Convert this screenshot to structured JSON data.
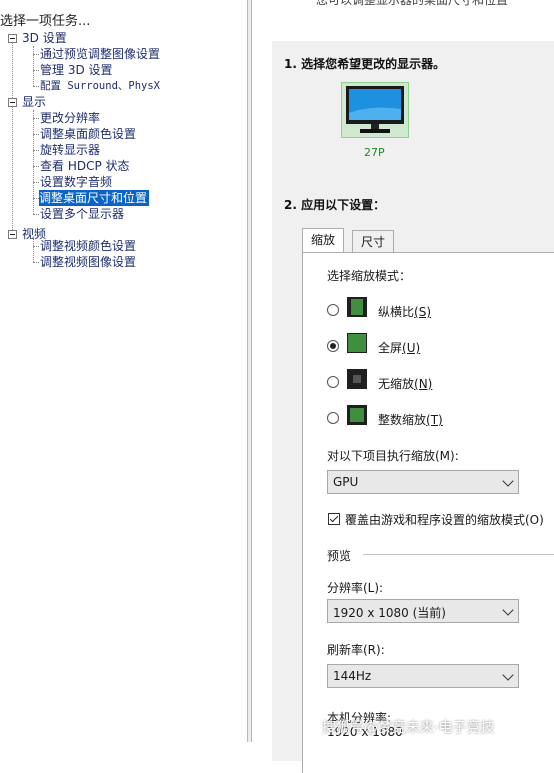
{
  "left_panel": {
    "title": "选择一项任务...",
    "tree": [
      {
        "label": "3D 设置",
        "children": [
          "通过预览调整图像设置",
          "管理 3D 设置",
          "配置 Surround、PhysX"
        ]
      },
      {
        "label": "显示",
        "children": [
          "更改分辨率",
          "调整桌面颜色设置",
          "旋转显示器",
          "查看 HDCP 状态",
          "设置数字音频",
          "调整桌面尺寸和位置",
          "设置多个显示器"
        ]
      },
      {
        "label": "视频",
        "children": [
          "调整视频颜色设置",
          "调整视频图像设置"
        ]
      }
    ],
    "selected": "调整桌面尺寸和位置"
  },
  "header_cut_text": "您可以调整显示器的桌面尺寸和位置",
  "step1": {
    "title": "1.  选择您希望更改的显示器。",
    "monitor_label": "27P",
    "monitor_icon": "monitor-icon"
  },
  "step2": {
    "title": "2.  应用以下设置："
  },
  "tabs": [
    "缩放",
    "尺寸"
  ],
  "scaling": {
    "mode_label": "选择缩放模式：",
    "modes": [
      {
        "label": "纵横比",
        "hotkey": "(S)",
        "checked": false,
        "icon": "aspect-ratio-icon"
      },
      {
        "label": "全屏",
        "hotkey": "(U)",
        "checked": true,
        "icon": "fullscreen-icon"
      },
      {
        "label": "无缩放",
        "hotkey": "(N)",
        "checked": false,
        "icon": "no-scaling-icon"
      },
      {
        "label": "整数缩放",
        "hotkey": "(T)",
        "checked": false,
        "icon": "integer-scaling-icon"
      }
    ],
    "perform_on_label": "对以下项目执行缩放(M):",
    "perform_on_value": "GPU",
    "override_label": "覆盖由游戏和程序设置的缩放模式(O)",
    "override_checked": true,
    "preview_label": "预览",
    "resolution_label": "分辨率(L):",
    "resolution_value": "1920 x 1080 (当前)",
    "refresh_label": "刷新率(R):",
    "refresh_value": "144Hz",
    "native_label": "本机分辨率:",
    "native_value": "1920 x 1080"
  },
  "watermark": "搜狐号@梦竞未来·电子竞技"
}
